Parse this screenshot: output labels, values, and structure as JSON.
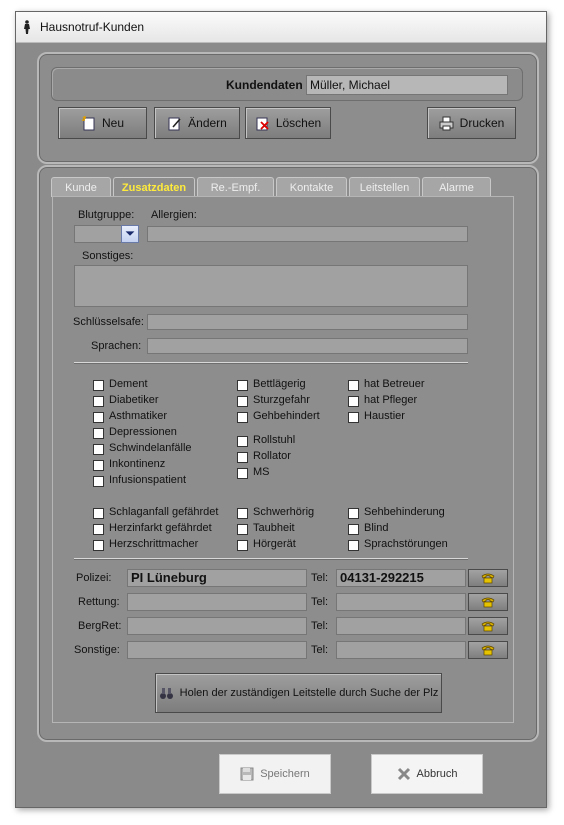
{
  "window": {
    "title": "Hausnotruf-Kunden"
  },
  "header": {
    "kundendaten_label": "Kundendaten",
    "kundendaten_value": "Müller, Michael"
  },
  "toolbar": {
    "neu": "Neu",
    "aendern": "Ändern",
    "loeschen": "Löschen",
    "drucken": "Drucken"
  },
  "tabs": [
    "Kunde",
    "Zusatzdaten",
    "Re.-Empf.",
    "Kontakte",
    "Leitstellen",
    "Alarme"
  ],
  "form": {
    "blutgruppe_label": "Blutgruppe:",
    "allergien_label": "Allergien:",
    "sonstiges_label": "Sonstiges:",
    "schluesselsafe_label": "Schlüsselsafe:",
    "sprachen_label": "Sprachen:"
  },
  "checks_col1": [
    "Dement",
    "Diabetiker",
    "Asthmatiker",
    "Depressionen",
    "Schwindelanfälle",
    "Inkontinenz",
    "Infusionspatient"
  ],
  "checks_col2a": [
    "Bettlägerig",
    "Sturzgefahr",
    "Gehbehindert"
  ],
  "checks_col2b": [
    "Rollstuhl",
    "Rollator",
    "MS"
  ],
  "checks_col3": [
    "hat Betreuer",
    "hat Pfleger",
    "Haustier"
  ],
  "checks_bottom": {
    "col1": [
      "Schlaganfall gefährdet",
      "Herzinfarkt gefährdet",
      "Herzschrittmacher"
    ],
    "col2": [
      "Schwerhörig",
      "Taubheit",
      "Hörgerät"
    ],
    "col3": [
      "Sehbehinderung",
      "Blind",
      "Sprachstörungen"
    ]
  },
  "contacts": {
    "tel_label": "Tel:",
    "rows": [
      {
        "label": "Polizei:",
        "name": "PI Lüneburg",
        "tel": "04131-292215"
      },
      {
        "label": "Rettung:",
        "name": "",
        "tel": ""
      },
      {
        "label": "BergRet:",
        "name": "",
        "tel": ""
      },
      {
        "label": "Sonstige:",
        "name": "",
        "tel": ""
      }
    ]
  },
  "search_button": "Holen der zuständigen Leitstelle durch Suche der Plz",
  "footer": {
    "save": "Speichern",
    "cancel": "Abbruch"
  }
}
